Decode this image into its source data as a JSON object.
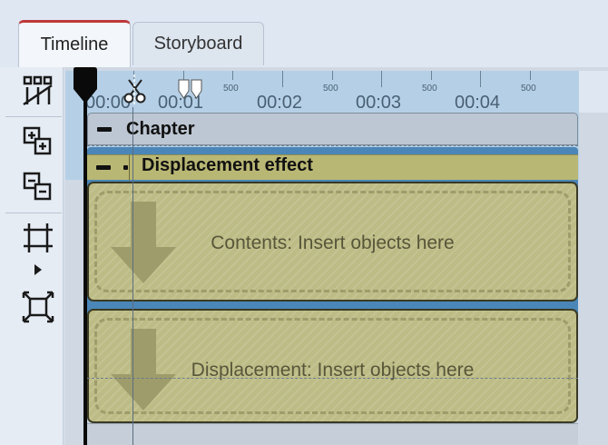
{
  "tabs": [
    {
      "label": "Timeline",
      "active": true
    },
    {
      "label": "Storyboard",
      "active": false
    }
  ],
  "toolbar": {
    "icons": [
      "split-tracks-icon",
      "add-track-icon",
      "remove-track-icon",
      "fit-width-icon",
      "expand-arrow-icon",
      "fit-all-icon"
    ]
  },
  "ruler": {
    "labels": [
      "00:00",
      "00:01",
      "00:02",
      "00:03",
      "00:04"
    ],
    "minor_label": "500"
  },
  "chapter": {
    "label": "Chapter"
  },
  "effect": {
    "label": "Displacement effect"
  },
  "drop_zones": {
    "contents": "Contents: Insert objects here",
    "displacement": "Displacement: Insert objects here"
  },
  "colors": {
    "tab_accent": "#c0393b",
    "ruler": "#b5d0e6",
    "effect": "#b9b774",
    "track_blue": "#4b86b8"
  }
}
